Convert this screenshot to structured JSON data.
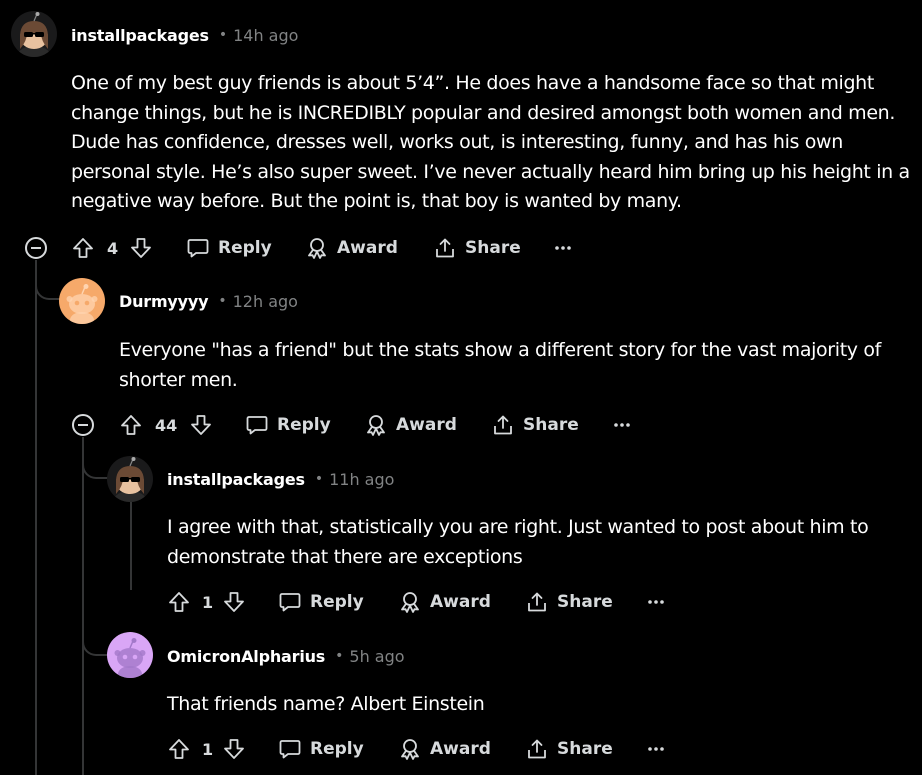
{
  "comments": [
    {
      "username": "installpackages",
      "separator": "•",
      "time": "14h ago",
      "body_lines": [
        "One of my best guy friends is about 5’4”. He does have a handsome face so that might",
        "change things, but he is INCREDIBLY popular and desired amongst both women and men.",
        "Dude has confidence, dresses well, works out, is interesting, funny, and has his own",
        "personal style. He’s also super sweet. I’ve never actually heard him bring up his height in a",
        "negative way before. But the point is, that boy is wanted by many."
      ],
      "votes": "4",
      "reply_label": "Reply",
      "award_label": "Award",
      "share_label": "Share",
      "more_label": "···"
    },
    {
      "username": "Durmyyyy",
      "separator": "•",
      "time": "12h ago",
      "body_lines": [
        "Everyone \"has a friend\" but the stats show a different story for the vast majority of",
        "shorter men."
      ],
      "votes": "44",
      "reply_label": "Reply",
      "award_label": "Award",
      "share_label": "Share",
      "more_label": "···"
    },
    {
      "username": "installpackages",
      "separator": "•",
      "time": "11h ago",
      "body_lines": [
        "I agree with that, statistically you are right. Just wanted to post about him to",
        "demonstrate that there are exceptions"
      ],
      "votes": "1",
      "reply_label": "Reply",
      "award_label": "Award",
      "share_label": "Share",
      "more_label": "···"
    },
    {
      "username": "OmicronAlpharius",
      "separator": "•",
      "time": "5h ago",
      "body_lines": [
        "That friends name? Albert Einstein"
      ],
      "votes": "1",
      "reply_label": "Reply",
      "award_label": "Award",
      "share_label": "Share",
      "more_label": "···"
    }
  ],
  "colors": {
    "background": "#000000",
    "text": "#ffffff",
    "muted": "#818384",
    "action": "#d7dadc",
    "thread_line": "#343536",
    "avatar_orange": "#f4a460",
    "avatar_purple": "#d8a7f5"
  },
  "icons": {
    "upvote": "upvote-arrow-icon",
    "downvote": "downvote-arrow-icon",
    "reply": "speech-bubble-icon",
    "award": "award-ribbon-icon",
    "share": "share-upload-icon",
    "more": "ellipsis-icon",
    "collapse": "minus-circle-icon"
  }
}
